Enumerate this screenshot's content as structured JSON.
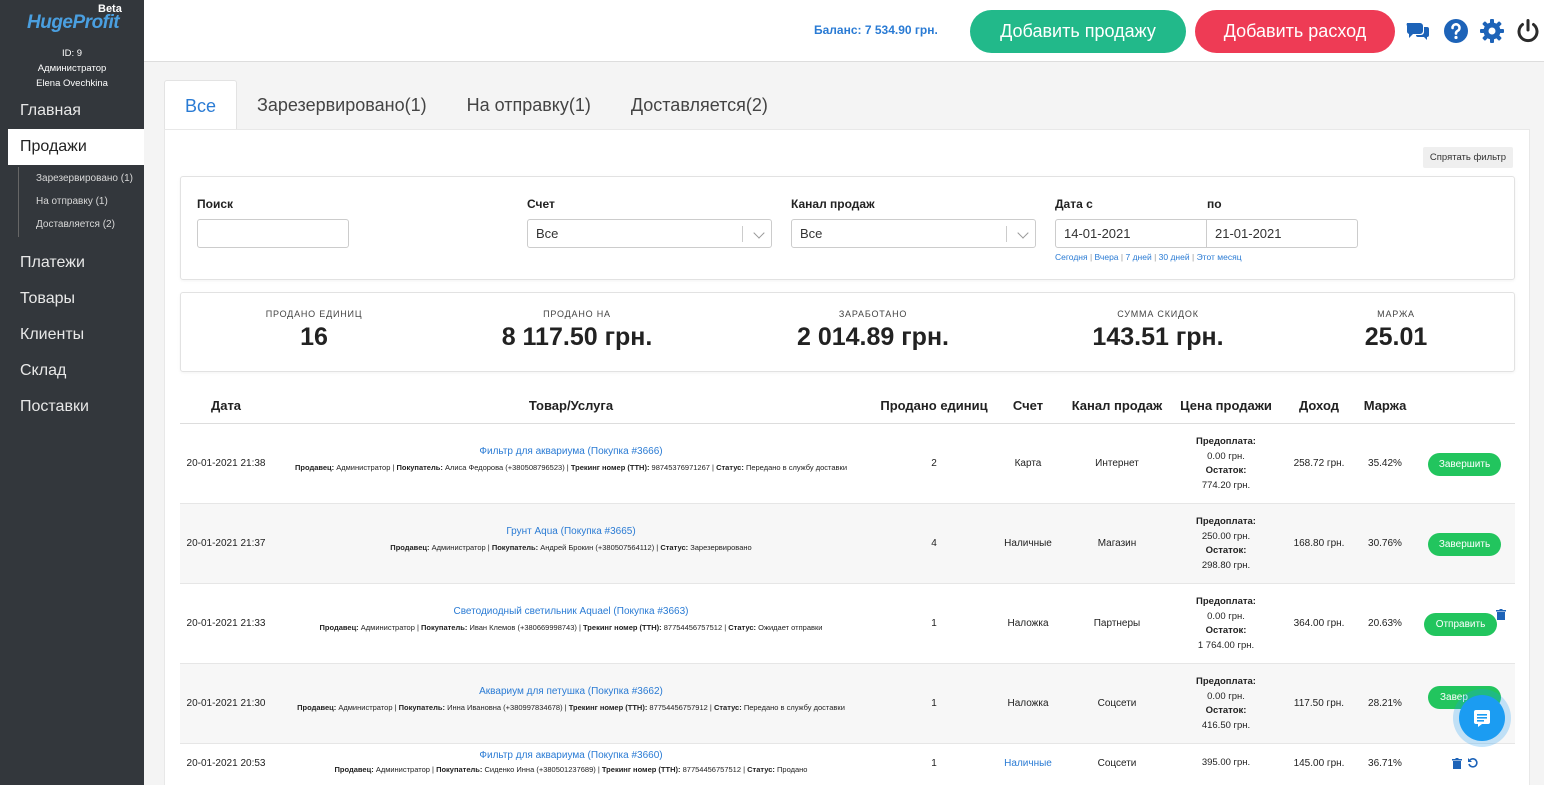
{
  "brand": {
    "logo": "HugeProfit",
    "beta": "Beta"
  },
  "user": {
    "id": "ID: 9",
    "role": "Администратор",
    "name": "Elena Ovechkina"
  },
  "sidebar": {
    "items": [
      {
        "label": "Главная"
      },
      {
        "label": "Продажи"
      },
      {
        "label": "Платежи"
      },
      {
        "label": "Товары"
      },
      {
        "label": "Клиенты"
      },
      {
        "label": "Склад"
      },
      {
        "label": "Поставки"
      }
    ],
    "subitems": [
      {
        "label": "Зарезервировано (1)"
      },
      {
        "label": "На отправку (1)"
      },
      {
        "label": "Доставляется (2)"
      }
    ]
  },
  "topbar": {
    "balance": "Баланс: 7 534.90 грн.",
    "add_sale": "Добавить продажу",
    "add_expense": "Добавить расход",
    "icons": [
      "chat-icon",
      "help-icon",
      "gear-icon",
      "power-icon"
    ]
  },
  "tabs": [
    {
      "label": "Все"
    },
    {
      "label": "Зарезервировано(1)"
    },
    {
      "label": "На отправку(1)"
    },
    {
      "label": "Доставляется(2)"
    }
  ],
  "filter": {
    "hide_filter": "Спрятать фильтр",
    "search_label": "Поиск",
    "search_value": "",
    "account_label": "Счет",
    "account_value": "Все",
    "channel_label": "Канал продаж",
    "channel_value": "Все",
    "date_from_label": "Дата с",
    "date_to_label": "по",
    "date_from": "14-01-2021",
    "date_to": "21-01-2021",
    "quick": [
      "Сегодня",
      "Вчера",
      "7 дней",
      "30 дней",
      "Этот месяц"
    ]
  },
  "stats": [
    {
      "label": "ПРОДАНО ЕДИНИЦ",
      "value": "16"
    },
    {
      "label": "ПРОДАНО НА",
      "value": "8 117.50 грн."
    },
    {
      "label": "ЗАРАБОТАНО",
      "value": "2 014.89 грн."
    },
    {
      "label": "СУММА СКИДОК",
      "value": "143.51 грн."
    },
    {
      "label": "МАРЖА",
      "value": "25.01"
    }
  ],
  "table": {
    "headers": [
      "Дата",
      "Товар/Услуга",
      "Продано единиц",
      "Счет",
      "Канал продаж",
      "Цена продажи",
      "Доход",
      "Маржа"
    ],
    "rows": [
      {
        "date": "20-01-2021 21:38",
        "product": "Фильтр для аквариума (Покупка #3666)",
        "seller_k": "Продавец:",
        "seller": "Администратор",
        "buyer_k": "Покупатель:",
        "buyer": "Алиса Федорова (+380508796523)",
        "track_k": "Трекинг номер (ТТН):",
        "track": "98745376971267",
        "status_k": "Статус:",
        "status": "Передано в службу доставки",
        "qty": "2",
        "account": "Карта",
        "channel": "Интернет",
        "prepay_k": "Предоплата:",
        "prepay": "0.00 грн.",
        "rest_k": "Остаток:",
        "rest": "774.20 грн.",
        "income": "258.72 грн.",
        "margin": "35.42%",
        "action": "Завершить"
      },
      {
        "date": "20-01-2021 21:37",
        "product": "Грунт Aqua (Покупка #3665)",
        "seller_k": "Продавец:",
        "seller": "Администратор",
        "buyer_k": "Покупатель:",
        "buyer": "Андрей Брокин (+380507564112)",
        "status_k": "Статус:",
        "status": "Зарезервировано",
        "qty": "4",
        "account": "Наличные",
        "channel": "Магазин",
        "prepay_k": "Предоплата:",
        "prepay": "250.00 грн.",
        "rest_k": "Остаток:",
        "rest": "298.80 грн.",
        "income": "168.80 грн.",
        "margin": "30.76%",
        "action": "Завершить"
      },
      {
        "date": "20-01-2021 21:33",
        "product": "Светодиодный светильник Aquael (Покупка #3663)",
        "seller_k": "Продавец:",
        "seller": "Администратор",
        "buyer_k": "Покупатель:",
        "buyer": "Иван Клемов (+380669998743)",
        "track_k": "Трекинг номер (ТТН):",
        "track": "87754456757512",
        "status_k": "Статус:",
        "status": "Ожидает отправки",
        "qty": "1",
        "account": "Наложка",
        "channel": "Партнеры",
        "prepay_k": "Предоплата:",
        "prepay": "0.00 грн.",
        "rest_k": "Остаток:",
        "rest": "1 764.00 грн.",
        "income": "364.00 грн.",
        "margin": "20.63%",
        "action": "Отправить"
      },
      {
        "date": "20-01-2021 21:30",
        "product": "Аквариум для петушка (Покупка #3662)",
        "seller_k": "Продавец:",
        "seller": "Администратор",
        "buyer_k": "Покупатель:",
        "buyer": "Инна Ивановна (+380997834678)",
        "track_k": "Трекинг номер (ТТН):",
        "track": "87754456757912",
        "status_k": "Статус:",
        "status": "Передано в службу доставки",
        "qty": "1",
        "account": "Наложка",
        "channel": "Соцсети",
        "prepay_k": "Предоплата:",
        "prepay": "0.00 грн.",
        "rest_k": "Остаток:",
        "rest": "416.50 грн.",
        "income": "117.50 грн.",
        "margin": "28.21%",
        "action": "Завер"
      },
      {
        "date": "20-01-2021 20:53",
        "product": "Фильтр для аквариума (Покупка #3660)",
        "seller_k": "Продавец:",
        "seller": "Администратор",
        "buyer_k": "Покупатель:",
        "buyer": "Сиденко Инна (+380501237689)",
        "track_k": "Трекинг номер (ТТН):",
        "track": "87754456757512",
        "status_k": "Статус:",
        "status": "Продано",
        "qty": "1",
        "account": "Наличные",
        "channel": "Соцсети",
        "price": "395.00 грн.",
        "income": "145.00 грн.",
        "margin": "36.71%"
      }
    ]
  },
  "colors": {
    "accent": "#2a7bd4",
    "sale_btn": "#22b98a",
    "expense_btn": "#ee3b55",
    "action_btn": "#22c55e",
    "sidebar": "#33373c"
  }
}
